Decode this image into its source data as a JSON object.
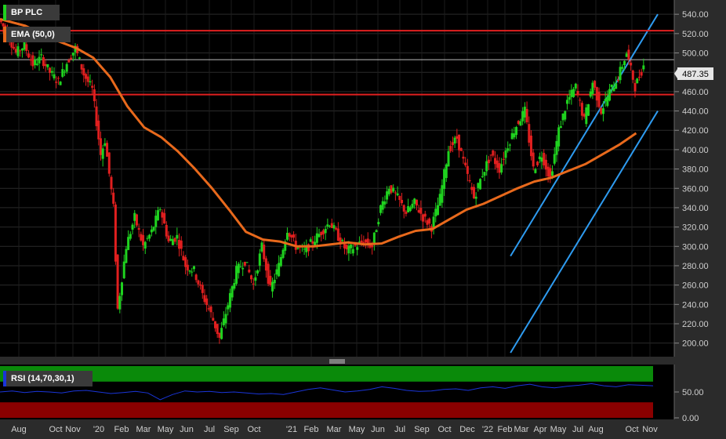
{
  "legend": {
    "symbol": "BP PLC",
    "indicator": "EMA (50,0)",
    "rsi": "RSI (14,70,30,1)"
  },
  "price_tag": "487.35",
  "colors": {
    "background": "#000000",
    "panel": "#2b2b2b",
    "up_candle": "#1fd21f",
    "down_candle": "#e01f1f",
    "ema": "#e8691c",
    "channel": "#2e9bf0",
    "resistance": "#e02020",
    "rsi_line": "#1a35d8",
    "rsi_overbought": "#0a8a0a",
    "rsi_oversold": "#8a0000"
  },
  "chart_data": {
    "type": "candlestick",
    "y_axis": {
      "ticks": [
        200,
        220,
        240,
        260,
        280,
        300,
        320,
        340,
        360,
        380,
        400,
        420,
        440,
        460,
        480,
        500,
        520,
        540
      ],
      "range": [
        190,
        545
      ],
      "position": "right",
      "grid": true
    },
    "x_axis": {
      "labels": [
        "Aug",
        "Oct",
        "Nov",
        "'20",
        "Feb",
        "Mar",
        "May",
        "Jun",
        "Jul",
        "Sep",
        "Oct",
        "'21",
        "Feb",
        "Mar",
        "May",
        "Jun",
        "Jul",
        "Sep",
        "Oct",
        "Dec",
        "'22",
        "Feb",
        "Mar",
        "Apr",
        "May",
        "Jul",
        "Aug",
        "Oct",
        "Nov"
      ]
    },
    "price_series": [
      {
        "t": 0,
        "v": 535
      },
      {
        "t": 2,
        "v": 520
      },
      {
        "t": 4,
        "v": 500
      },
      {
        "t": 6,
        "v": 508
      },
      {
        "t": 8,
        "v": 488
      },
      {
        "t": 10,
        "v": 495
      },
      {
        "t": 12,
        "v": 480
      },
      {
        "t": 14,
        "v": 470
      },
      {
        "t": 16,
        "v": 490
      },
      {
        "t": 18,
        "v": 505
      },
      {
        "t": 20,
        "v": 478
      },
      {
        "t": 22,
        "v": 462
      },
      {
        "t": 24,
        "v": 395
      },
      {
        "t": 25,
        "v": 410
      },
      {
        "t": 27,
        "v": 340
      },
      {
        "t": 28,
        "v": 235
      },
      {
        "t": 30,
        "v": 300
      },
      {
        "t": 32,
        "v": 330
      },
      {
        "t": 34,
        "v": 300
      },
      {
        "t": 36,
        "v": 315
      },
      {
        "t": 38,
        "v": 340
      },
      {
        "t": 40,
        "v": 305
      },
      {
        "t": 42,
        "v": 310
      },
      {
        "t": 44,
        "v": 280
      },
      {
        "t": 46,
        "v": 275
      },
      {
        "t": 48,
        "v": 250
      },
      {
        "t": 50,
        "v": 230
      },
      {
        "t": 52,
        "v": 205
      },
      {
        "t": 54,
        "v": 240
      },
      {
        "t": 56,
        "v": 275
      },
      {
        "t": 58,
        "v": 285
      },
      {
        "t": 60,
        "v": 260
      },
      {
        "t": 62,
        "v": 300
      },
      {
        "t": 64,
        "v": 255
      },
      {
        "t": 66,
        "v": 280
      },
      {
        "t": 68,
        "v": 318
      },
      {
        "t": 70,
        "v": 300
      },
      {
        "t": 72,
        "v": 295
      },
      {
        "t": 74,
        "v": 305
      },
      {
        "t": 76,
        "v": 315
      },
      {
        "t": 78,
        "v": 325
      },
      {
        "t": 80,
        "v": 310
      },
      {
        "t": 82,
        "v": 295
      },
      {
        "t": 84,
        "v": 300
      },
      {
        "t": 86,
        "v": 305
      },
      {
        "t": 88,
        "v": 300
      },
      {
        "t": 90,
        "v": 340
      },
      {
        "t": 92,
        "v": 362
      },
      {
        "t": 94,
        "v": 350
      },
      {
        "t": 96,
        "v": 335
      },
      {
        "t": 98,
        "v": 345
      },
      {
        "t": 100,
        "v": 330
      },
      {
        "t": 102,
        "v": 320
      },
      {
        "t": 104,
        "v": 350
      },
      {
        "t": 106,
        "v": 400
      },
      {
        "t": 108,
        "v": 412
      },
      {
        "t": 110,
        "v": 380
      },
      {
        "t": 112,
        "v": 350
      },
      {
        "t": 114,
        "v": 375
      },
      {
        "t": 116,
        "v": 395
      },
      {
        "t": 118,
        "v": 380
      },
      {
        "t": 120,
        "v": 405
      },
      {
        "t": 122,
        "v": 425
      },
      {
        "t": 124,
        "v": 440
      },
      {
        "t": 126,
        "v": 380
      },
      {
        "t": 128,
        "v": 395
      },
      {
        "t": 130,
        "v": 370
      },
      {
        "t": 132,
        "v": 420
      },
      {
        "t": 134,
        "v": 450
      },
      {
        "t": 136,
        "v": 465
      },
      {
        "t": 138,
        "v": 430
      },
      {
        "t": 140,
        "v": 470
      },
      {
        "t": 142,
        "v": 440
      },
      {
        "t": 144,
        "v": 460
      },
      {
        "t": 146,
        "v": 475
      },
      {
        "t": 148,
        "v": 500
      },
      {
        "t": 150,
        "v": 465
      },
      {
        "t": 152,
        "v": 487
      }
    ],
    "ema_series": [
      {
        "t": 0,
        "v": 535
      },
      {
        "t": 6,
        "v": 528
      },
      {
        "t": 12,
        "v": 515
      },
      {
        "t": 18,
        "v": 505
      },
      {
        "t": 22,
        "v": 495
      },
      {
        "t": 26,
        "v": 475
      },
      {
        "t": 30,
        "v": 445
      },
      {
        "t": 34,
        "v": 423
      },
      {
        "t": 38,
        "v": 413
      },
      {
        "t": 42,
        "v": 398
      },
      {
        "t": 46,
        "v": 380
      },
      {
        "t": 50,
        "v": 360
      },
      {
        "t": 54,
        "v": 338
      },
      {
        "t": 58,
        "v": 315
      },
      {
        "t": 62,
        "v": 307
      },
      {
        "t": 66,
        "v": 305
      },
      {
        "t": 70,
        "v": 300
      },
      {
        "t": 74,
        "v": 300
      },
      {
        "t": 78,
        "v": 302
      },
      {
        "t": 82,
        "v": 304
      },
      {
        "t": 86,
        "v": 302
      },
      {
        "t": 90,
        "v": 303
      },
      {
        "t": 94,
        "v": 310
      },
      {
        "t": 98,
        "v": 316
      },
      {
        "t": 102,
        "v": 318
      },
      {
        "t": 106,
        "v": 328
      },
      {
        "t": 110,
        "v": 338
      },
      {
        "t": 114,
        "v": 344
      },
      {
        "t": 118,
        "v": 352
      },
      {
        "t": 122,
        "v": 360
      },
      {
        "t": 126,
        "v": 367
      },
      {
        "t": 130,
        "v": 371
      },
      {
        "t": 134,
        "v": 378
      },
      {
        "t": 138,
        "v": 385
      },
      {
        "t": 142,
        "v": 395
      },
      {
        "t": 146,
        "v": 405
      },
      {
        "t": 150,
        "v": 417
      }
    ],
    "t_range": [
      0,
      154
    ],
    "channel_upper": [
      {
        "t": 59,
        "v": 290
      },
      {
        "t": 154,
        "v": 540
      }
    ],
    "channel_lower": [
      {
        "t": 59,
        "v": 190
      },
      {
        "t": 154,
        "v": 440
      }
    ],
    "resistance_levels": [
      523,
      457
    ],
    "last_price_line": 493,
    "rsi": {
      "ticks": [
        0.0,
        50.0
      ],
      "overbought": 70,
      "oversold": 30,
      "range": [
        0,
        100
      ],
      "values": [
        50,
        52,
        49,
        51,
        50,
        48,
        52,
        53,
        50,
        47,
        49,
        51,
        48,
        35,
        45,
        52,
        50,
        51,
        49,
        50,
        48,
        46,
        47,
        45,
        50,
        55,
        58,
        54,
        50,
        52,
        55,
        60,
        57,
        53,
        51,
        52,
        55,
        56,
        53,
        58,
        60,
        57,
        62,
        65,
        60,
        58,
        61,
        63,
        66,
        62,
        60,
        64,
        63,
        62
      ]
    }
  }
}
